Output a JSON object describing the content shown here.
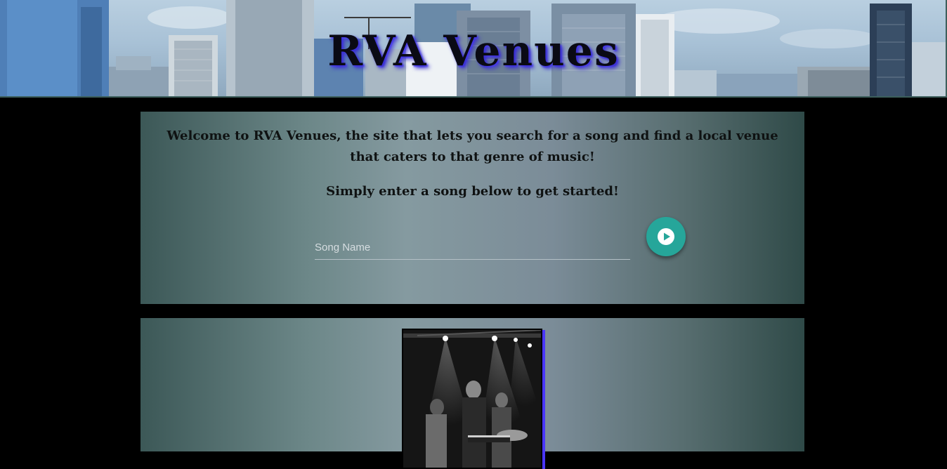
{
  "header": {
    "title": "RVA Venues",
    "banner_image": "richmond-skyline-photo"
  },
  "search_card": {
    "welcome": "Welcome to RVA Venues, the site that lets you search for a song and find a local venue that caters to that genre of music!",
    "instruction": "Simply enter a song below to get started!",
    "song_input": {
      "placeholder": "Song Name",
      "value": ""
    },
    "submit_icon": "play-circle-icon",
    "accent_color": "#26a69a"
  },
  "results_card": {
    "image": "concert-band-photo"
  },
  "colors": {
    "page_background": "#000000",
    "title_glow": "#4b3cff",
    "card_gradient_center": "#859aa0",
    "card_gradient_edge": "#2f4a48"
  }
}
